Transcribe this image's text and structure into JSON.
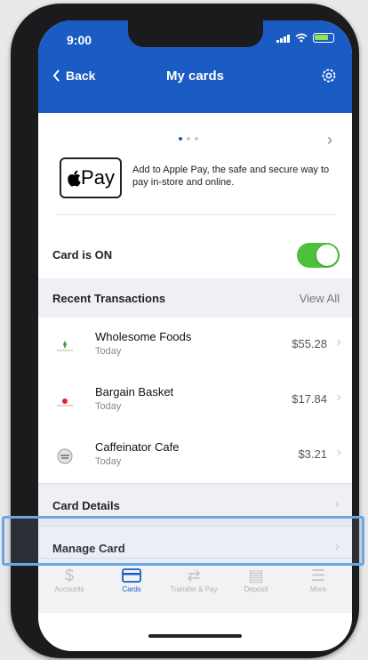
{
  "status_bar": {
    "time": "9:00"
  },
  "nav": {
    "back_label": "Back",
    "title": "My cards"
  },
  "pager": {
    "pages": 3,
    "active_page": 1
  },
  "apple_pay": {
    "badge_label": "Pay",
    "description": "Add to Apple Pay, the safe and secure way to pay in-store and online."
  },
  "card_status": {
    "label": "Card is ON",
    "toggle_on": true
  },
  "recent": {
    "title": "Recent Transactions",
    "view_all": "View All",
    "items": [
      {
        "name": "Wholesome Foods",
        "date": "Today",
        "amount": "$55.28",
        "icon": "grocery-icon"
      },
      {
        "name": "Bargain Basket",
        "date": "Today",
        "amount": "$17.84",
        "icon": "shopping-icon"
      },
      {
        "name": "Caffeinator Cafe",
        "date": "Today",
        "amount": "$3.21",
        "icon": "coffee-icon"
      }
    ]
  },
  "sections": {
    "card_details": "Card Details",
    "manage_card": "Manage Card"
  },
  "tabbar": {
    "tabs": [
      {
        "label": "Accounts",
        "icon": "dollar-icon"
      },
      {
        "label": "Cards",
        "icon": "card-icon"
      },
      {
        "label": "Transfer & Pay",
        "icon": "transfer-icon"
      },
      {
        "label": "Deposit",
        "icon": "deposit-icon"
      },
      {
        "label": "More",
        "icon": "menu-icon"
      }
    ],
    "active": 1
  },
  "colors": {
    "brand_blue": "#1a5cc4",
    "toggle_green": "#4cc13a",
    "highlight_outline": "#6aa6e4"
  }
}
